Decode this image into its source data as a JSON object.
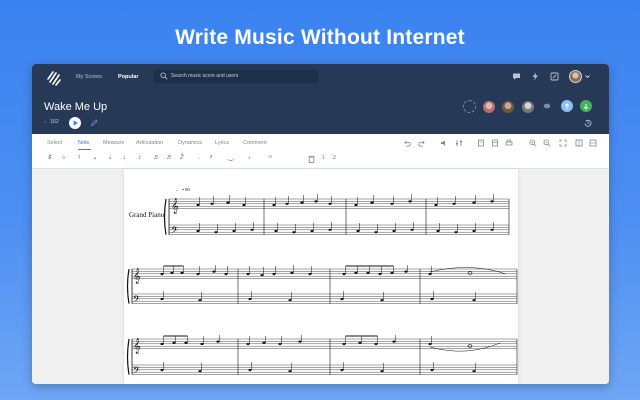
{
  "headline": "Write Music Without Internet",
  "nav": {
    "my_scores": "My Scores",
    "popular": "Popular"
  },
  "search": {
    "placeholder": "Search music score and users"
  },
  "score": {
    "title": "Wake Me Up",
    "tempo": "♩ 162",
    "instrument": "Grand Piano",
    "tempo_marking": "♩ = 80"
  },
  "tabs": [
    "Select",
    "Note",
    "Measure",
    "Articulation",
    "Dynamics",
    "Lyrics",
    "Comment"
  ],
  "tools": {
    "sharp": "♯",
    "flat": "♭",
    "whole": "𝅝",
    "eighth": "♪",
    "sixteenth": "♬",
    "quarter": "♩",
    "dot": ".",
    "tuplet": "⁽³⁾",
    "voice1": "1",
    "voice2": "2"
  },
  "colors": {
    "background": "#3a82f0",
    "topbar": "#263957",
    "accent": "#3a7bf2",
    "green": "#3fb25e"
  },
  "icons": [
    "logo-icon",
    "search-icon",
    "chat-icon",
    "lightning-icon",
    "edit-icon",
    "caret-down-icon",
    "play-icon",
    "pencil-icon",
    "undo-icon",
    "redo-icon",
    "history-icon",
    "trash-icon"
  ]
}
